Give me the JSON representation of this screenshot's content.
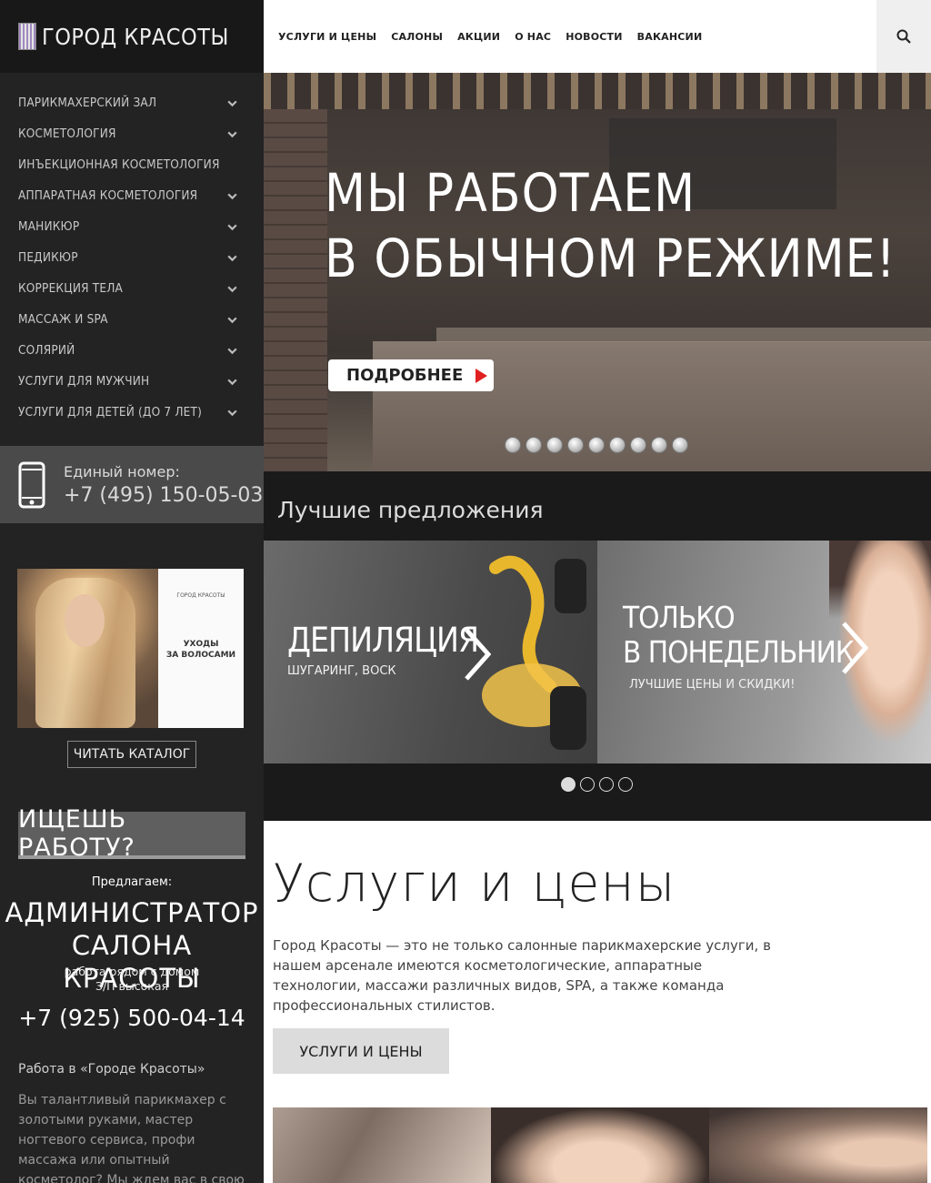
{
  "brand": {
    "logo_text": "ГОРОД КРАСОТЫ"
  },
  "nav": {
    "items": [
      {
        "label": "УСЛУГИ И ЦЕНЫ"
      },
      {
        "label": "САЛОНЫ"
      },
      {
        "label": "АКЦИИ"
      },
      {
        "label": "О НАС"
      },
      {
        "label": "НОВОСТИ"
      },
      {
        "label": "ВАКАНСИИ"
      }
    ],
    "search_icon": "search-icon"
  },
  "sidebar": {
    "menu": [
      {
        "label": "ПАРИКМАХЕРСКИЙ ЗАЛ"
      },
      {
        "label": "КОСМЕТОЛОГИЯ"
      },
      {
        "label": "ИНЪЕКЦИОННАЯ КОСМЕТОЛОГИЯ"
      },
      {
        "label": "АППАРАТНАЯ КОСМЕТОЛОГИЯ"
      },
      {
        "label": "МАНИКЮР"
      },
      {
        "label": "ПЕДИКЮР"
      },
      {
        "label": "КОРРЕКЦИЯ ТЕЛА"
      },
      {
        "label": "МАССАЖ И SPA"
      },
      {
        "label": "СОЛЯРИЙ"
      },
      {
        "label": "УСЛУГИ ДЛЯ МУЖЧИН"
      },
      {
        "label": "УСЛУГИ ДЛЯ ДЕТЕЙ (ДО 7 ЛЕТ)"
      }
    ],
    "phone": {
      "label": "Единый номер:",
      "number": "+7 (495) 150-05-03"
    },
    "catalog": {
      "logo": "ГОРОД КРАСОТЫ",
      "title_line1": "УХОДЫ",
      "title_line2": "ЗА ВОЛОСАМИ",
      "button": "ЧИТАТЬ КАТАЛОГ"
    },
    "job": {
      "heading": "ИЩЕШЬ РАБОТУ?",
      "offer_label": "Предлагаем:",
      "offer_line1": "АДМИНИСТРАТОР",
      "offer_line2": "САЛОНА КРАСОТЫ",
      "sub_line1": "работа рядом с домом",
      "sub_line2": "З/П высокая",
      "phone": "+7 (925) 500-04-14"
    },
    "work": {
      "title": "Работа в «Городе Красоты»",
      "text": "Вы талантливый парикмахер с золотыми руками, мастер ногтевого сервиса, профи массажа или опытный косметолог? Мы ждем вас в свою команду!"
    }
  },
  "hero": {
    "title_line1": "МЫ РАБОТАЕМ",
    "title_line2": "В ОБЫЧНОМ РЕЖИМЕ!",
    "button": "ПОДРОБНЕЕ",
    "slide_count": 9
  },
  "offers": {
    "title": "Лучшие предложения",
    "cards": [
      {
        "title": "ДЕПИЛЯЦИЯ",
        "subtitle": "ШУГАРИНГ, ВОСК"
      },
      {
        "title_line1": "ТОЛЬКО",
        "title_line2": "В ПОНЕДЕЛЬНИК",
        "subtitle": "ЛУЧШИЕ ЦЕНЫ И СКИДКИ!"
      }
    ],
    "page_count": 4,
    "active_page": 1
  },
  "services": {
    "title": "Услуги и цены",
    "text": "Город Красоты — это не только салонные парикмахерские услуги, в нашем арсенале имеются косметологические, аппаратные технологии, массажи различных видов, SPA, а также команда профессиональных стилистов.",
    "button": "УСЛУГИ И ЦЕНЫ"
  }
}
